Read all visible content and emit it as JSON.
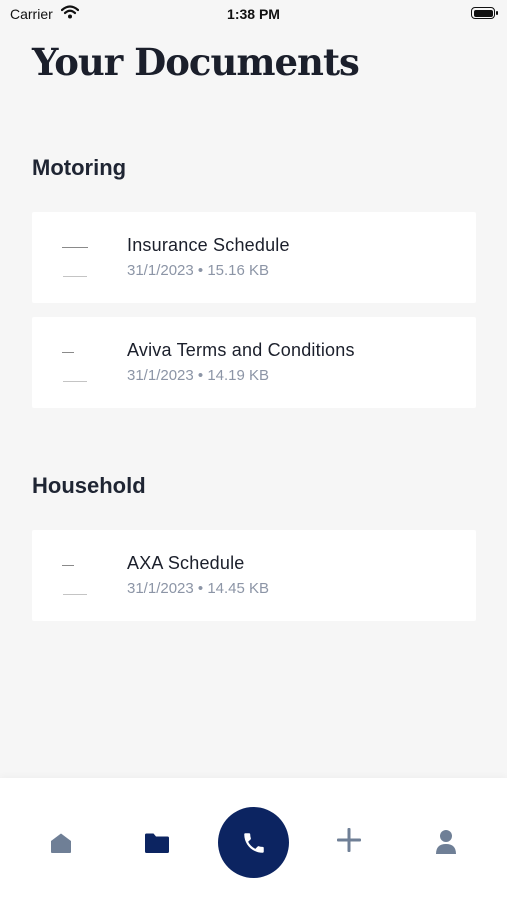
{
  "status_bar": {
    "carrier": "Carrier",
    "time": "1:38 PM"
  },
  "page_title": "Your Documents",
  "sections": [
    {
      "title": "Motoring",
      "documents": [
        {
          "name": "Insurance Schedule",
          "meta": "31/1/2023 • 15.16 KB"
        },
        {
          "name": "Aviva Terms and Conditions",
          "meta": "31/1/2023 • 14.19 KB"
        }
      ]
    },
    {
      "title": "Household",
      "documents": [
        {
          "name": "AXA Schedule",
          "meta": "31/1/2023 • 14.45 KB"
        }
      ]
    }
  ],
  "tab_bar": {
    "items": [
      {
        "icon": "home-icon",
        "active": false
      },
      {
        "icon": "folder-icon",
        "active": true
      },
      {
        "icon": "phone-icon",
        "active": false
      },
      {
        "icon": "plus-icon",
        "active": false
      },
      {
        "icon": "user-icon",
        "active": false
      }
    ]
  },
  "colors": {
    "accent": "#0c2461",
    "inactive_icon": "#6f7f96",
    "background": "#f6f6f6"
  }
}
